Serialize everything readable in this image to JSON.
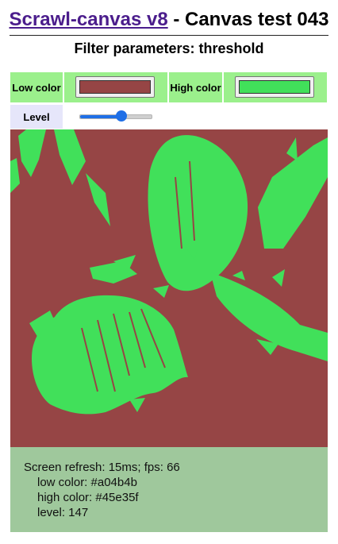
{
  "header": {
    "link_text": "Scrawl-canvas v8",
    "title_rest": " - Canvas test 043",
    "subtitle": "Filter parameters: threshold"
  },
  "controls": {
    "low_label": "Low color",
    "low_value": "#a04b4b",
    "high_label": "High color",
    "high_value": "#45e35f",
    "level_label": "Level",
    "level_value": 147,
    "level_min": 0,
    "level_max": 255
  },
  "colors": {
    "low": "#964545",
    "high": "#41e05a",
    "panel_green": "#9bf08c",
    "panel_lavender": "#e6e6fa",
    "status_bg": "#9fc89c"
  },
  "status": {
    "line1": "Screen refresh: 15ms; fps: 66",
    "line2": "low color: #a04b4b",
    "line3": "high color: #45e35f",
    "line4": "level: 147"
  }
}
